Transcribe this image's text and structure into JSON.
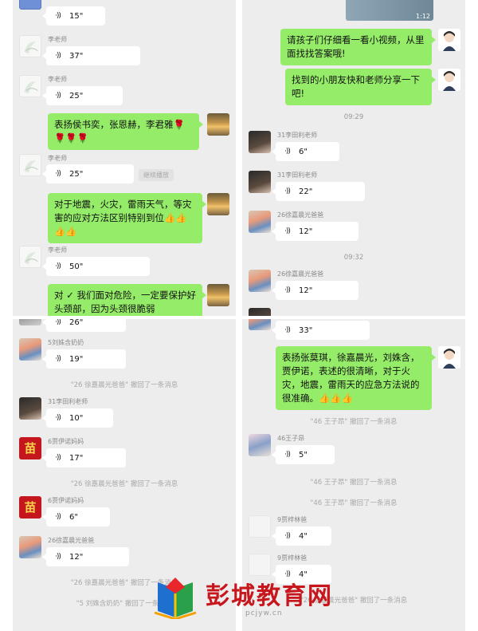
{
  "panel1": {
    "top_voice_duration": "15\"",
    "messages": [
      {
        "sender": "李老师",
        "duration": "37\""
      },
      {
        "sender": "李老师",
        "duration": "25\""
      },
      {
        "text": "表扬侯书奕，张恩赫，李君雅🌹🌹🌹🌹"
      },
      {
        "sender": "李老师",
        "duration": "25\"",
        "hint": "继续播放"
      },
      {
        "text": "对于地震，火灾，雷雨天气，等灾害的应对方法区别特别到位👍👍👍👍"
      },
      {
        "sender": "李老师",
        "duration": "50\""
      },
      {
        "text": "对 ✓ 我们面对危险，一定要保护好头颈部，因为头颈很脆弱"
      }
    ]
  },
  "panel2": {
    "video_duration": "1:12",
    "messages": [
      {
        "text": "请孩子们仔细看一看小视频，从里面找找答案哦!"
      },
      {
        "text": "找到的小朋友快和老师分享一下吧!"
      },
      {
        "time": "09:29"
      },
      {
        "sender": "31李田利老师",
        "duration": "6\""
      },
      {
        "sender": "31李田利老师",
        "duration": "22\""
      },
      {
        "sender": "26徐嘉晨光爸爸",
        "duration": "12\""
      },
      {
        "time": "09:32"
      },
      {
        "sender": "26徐嘉晨光爸爸",
        "duration": "12\""
      }
    ]
  },
  "panel3": {
    "top_voice_duration": "26\"",
    "messages": [
      {
        "sender": "5刘姝含奶奶",
        "duration": "19\""
      },
      {
        "system": "\"26 徐嘉晨光爸爸\" 撤回了一条消息"
      },
      {
        "sender": "31李田利老师",
        "duration": "10\""
      },
      {
        "sender": "6贾伊诺妈妈",
        "duration": "17\""
      },
      {
        "system": "\"26 徐嘉晨光爸爸\" 撤回了一条消息"
      },
      {
        "sender": "6贾伊诺妈妈",
        "duration": "6\""
      },
      {
        "sender": "26徐嘉晨光爸爸",
        "duration": "12\""
      },
      {
        "system": "\"26 徐嘉晨光爸爸\" 撤回了一条消息"
      },
      {
        "system": "\"5 刘姝含奶奶\" 撤回了一条消息"
      }
    ],
    "avatar_char": "苗"
  },
  "panel4": {
    "top_voice_duration": "33\"",
    "messages": [
      {
        "text": "表扬张莫琪，徐嘉晨光，刘姝含，贾伊诺，表述的很清晰，对于火灾，地震，雷雨天的应急方法说的很准确。👍👍👍"
      },
      {
        "system": "\"46 王子昂\" 撤回了一条消息"
      },
      {
        "sender": "46王子昂",
        "duration": "5\""
      },
      {
        "system": "\"46 王子昂\" 撤回了一条消息"
      },
      {
        "system": "\"46 王子昂\" 撤回了一条消息"
      },
      {
        "sender": "9贾梓林爸",
        "duration": "4\""
      },
      {
        "sender": "9贾梓林爸",
        "duration": "4\""
      },
      {
        "system": "\"26 徐嘉晨光爸爸\" 撤回了一条消息"
      }
    ]
  },
  "watermark": {
    "title": "彭城教育网",
    "subtitle": "pcjyw.cn"
  },
  "colors": {
    "chat_bg": "#ededed",
    "green_bubble": "#95ec69",
    "watermark_red": "#c8161d"
  },
  "icons": {
    "voice": "voice-wave-icon"
  }
}
